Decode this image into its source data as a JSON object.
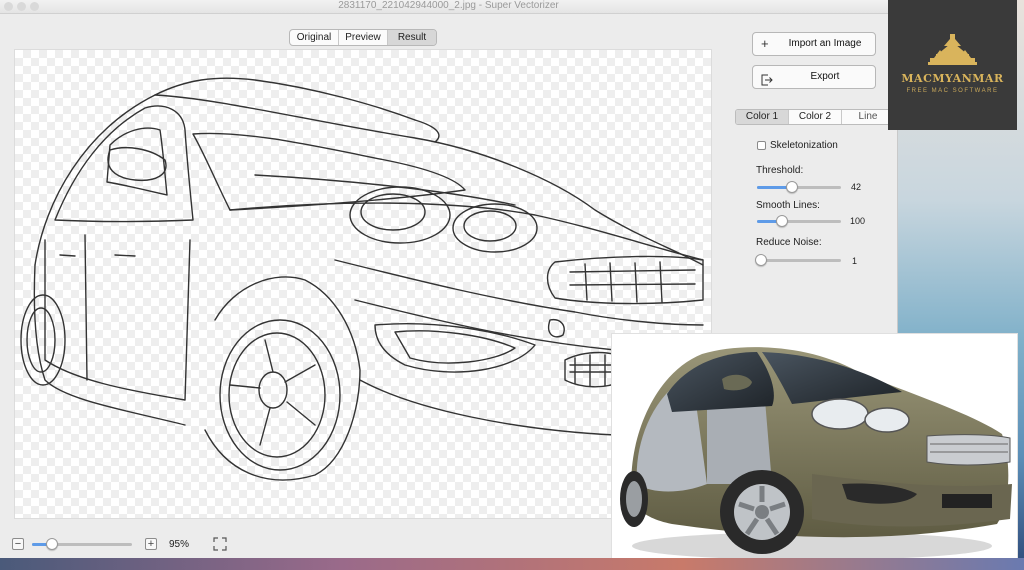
{
  "window": {
    "title": "2831170_221042944000_2.jpg - Super Vectorizer"
  },
  "view_modes": {
    "items": [
      "Original",
      "Preview",
      "Result"
    ],
    "selected": "Result"
  },
  "toolbar": {
    "import_label": "Import an Image",
    "export_label": "Export"
  },
  "color_tabs": {
    "items": [
      "Color 1",
      "Color 2",
      "Line"
    ],
    "selected": "Color 1"
  },
  "options": {
    "skeletonization_label": "Skeletonization",
    "skeletonization_checked": false,
    "threshold_label": "Threshold:",
    "threshold_value": "42",
    "threshold_level": 0.42,
    "smooth_lines_label": "Smooth Lines:",
    "smooth_lines_value": "100",
    "smooth_lines_level": 0.3,
    "reduce_noise_label": "Reduce Noise:",
    "reduce_noise_value": "1",
    "reduce_noise_level": 0.02
  },
  "zoom": {
    "out_symbol": "−",
    "in_symbol": "+",
    "value": "95%",
    "level": 0.2
  },
  "logo": {
    "name": "MACMYANMAR",
    "tagline": "FREE MAC SOFTWARE"
  },
  "colors": {
    "accent": "#5e9be8",
    "logo_bg": "#3a3a3a",
    "logo_gold": "#d9b45c",
    "car_body": "#7d7a5a"
  },
  "icons": {
    "import": "plus-icon",
    "export": "export-icon",
    "fullscreen": "fullscreen-icon"
  }
}
